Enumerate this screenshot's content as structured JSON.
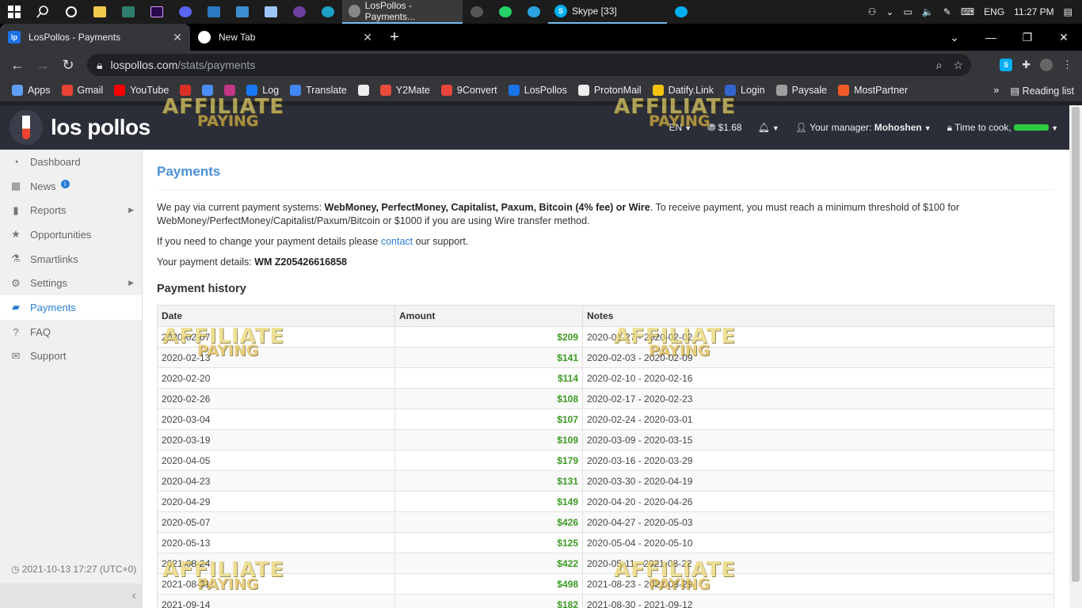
{
  "taskbar": {
    "apps": [
      "start",
      "search",
      "cortana",
      "explorer",
      "app1",
      "premiere",
      "app2",
      "app3",
      "app4",
      "app5",
      "app6",
      "edge"
    ],
    "active_tab_title": "LosPollos - Payments...",
    "skype_title": "Skype [33]",
    "tray": {
      "lang": "ENG",
      "time": "11:27 PM"
    }
  },
  "browser": {
    "tabs": [
      {
        "title": "LosPollos - Payments",
        "favicon": "lp"
      },
      {
        "title": "New Tab",
        "favicon": "chrome"
      }
    ],
    "url_host": "lospollos.com",
    "url_path": "/stats/payments",
    "bookmarks": [
      {
        "label": "Apps",
        "color": "#5f9ef5"
      },
      {
        "label": "Gmail",
        "color": "#ea4335"
      },
      {
        "label": "YouTube",
        "color": "#ff0000"
      },
      {
        "label": "",
        "color": "#d93025"
      },
      {
        "label": "",
        "color": "#4a8ef5"
      },
      {
        "label": "",
        "color": "#c13584"
      },
      {
        "label": "Log",
        "color": "#1877f2"
      },
      {
        "label": "Translate",
        "color": "#4285f4"
      },
      {
        "label": "",
        "color": "#eeeeee"
      },
      {
        "label": "Y2Mate",
        "color": "#e74c3c"
      },
      {
        "label": "9Convert",
        "color": "#e8453c"
      },
      {
        "label": "LosPollos",
        "color": "#1a73e8"
      },
      {
        "label": "ProtonMail",
        "color": "#eeeeee"
      },
      {
        "label": "Datify.Link",
        "color": "#f4c20d"
      },
      {
        "label": "Login",
        "color": "#3366cc"
      },
      {
        "label": "Paysale",
        "color": "#9e9e9e"
      },
      {
        "label": "MostPartner",
        "color": "#f15a24"
      }
    ],
    "more_bookmarks": "»",
    "reading_list": "Reading list"
  },
  "header": {
    "logo_text": "los pollos",
    "lang": "EN",
    "balance": "$1.68",
    "manager_label": "Your manager:",
    "manager_name": "Mohoshen",
    "time_to_cook": "Time to cook,"
  },
  "sidebar": {
    "items": [
      {
        "label": "Dashboard",
        "icon": "dashboard-icon"
      },
      {
        "label": "News",
        "icon": "calendar-icon"
      },
      {
        "label": "Reports",
        "icon": "bar-chart-icon"
      },
      {
        "label": "Opportunities",
        "icon": "star-icon"
      },
      {
        "label": "Smartlinks",
        "icon": "flask-icon"
      },
      {
        "label": "Settings",
        "icon": "gear-icon"
      },
      {
        "label": "Payments",
        "icon": "wallet-icon"
      },
      {
        "label": "FAQ",
        "icon": "question-icon"
      },
      {
        "label": "Support",
        "icon": "envelope-icon"
      }
    ],
    "active": "Payments",
    "timestamp": "2021-10-13 17:27 (UTC+0)"
  },
  "page": {
    "title": "Payments",
    "intro_prefix": "We pay via current payment systems: ",
    "intro_bold": "WebMoney, PerfectMoney, Capitalist, Paxum, Bitcoin (4% fee) or Wire",
    "intro_suffix": ". To receive payment, you must reach a minimum threshold of $100 for WebMoney/PerfectMoney/Capitalist/Paxum/Bitcoin or $1000 if you are using Wire transfer method.",
    "change_prefix": "If you need to change your payment details please ",
    "change_link": "contact",
    "change_suffix": " our support.",
    "details_label": "Your payment details: ",
    "details_value": "WM Z205426616858",
    "history_title": "Payment history",
    "columns": [
      "Date",
      "Amount",
      "Notes"
    ],
    "rows": [
      {
        "date": "2020-02-07",
        "amount": "$209",
        "notes": "2020-01-27 - 2020-02-02"
      },
      {
        "date": "2020-02-13",
        "amount": "$141",
        "notes": "2020-02-03 - 2020-02-09"
      },
      {
        "date": "2020-02-20",
        "amount": "$114",
        "notes": "2020-02-10 - 2020-02-16"
      },
      {
        "date": "2020-02-26",
        "amount": "$108",
        "notes": "2020-02-17 - 2020-02-23"
      },
      {
        "date": "2020-03-04",
        "amount": "$107",
        "notes": "2020-02-24 - 2020-03-01"
      },
      {
        "date": "2020-03-19",
        "amount": "$109",
        "notes": "2020-03-09 - 2020-03-15"
      },
      {
        "date": "2020-04-05",
        "amount": "$179",
        "notes": "2020-03-16 - 2020-03-29"
      },
      {
        "date": "2020-04-23",
        "amount": "$131",
        "notes": "2020-03-30 - 2020-04-19"
      },
      {
        "date": "2020-04-29",
        "amount": "$149",
        "notes": "2020-04-20 - 2020-04-26"
      },
      {
        "date": "2020-05-07",
        "amount": "$426",
        "notes": "2020-04-27 - 2020-05-03"
      },
      {
        "date": "2020-05-13",
        "amount": "$125",
        "notes": "2020-05-04 - 2020-05-10"
      },
      {
        "date": "2021-08-24",
        "amount": "$422",
        "notes": "2020-05-11 - 2021-08-22"
      },
      {
        "date": "2021-08-31",
        "amount": "$498",
        "notes": "2021-08-23 - 2021-08-29"
      },
      {
        "date": "2021-09-14",
        "amount": "$182",
        "notes": "2021-08-30 - 2021-09-12"
      }
    ]
  },
  "watermark": {
    "line1": "AFFILIATE",
    "line2": "PAYING"
  }
}
